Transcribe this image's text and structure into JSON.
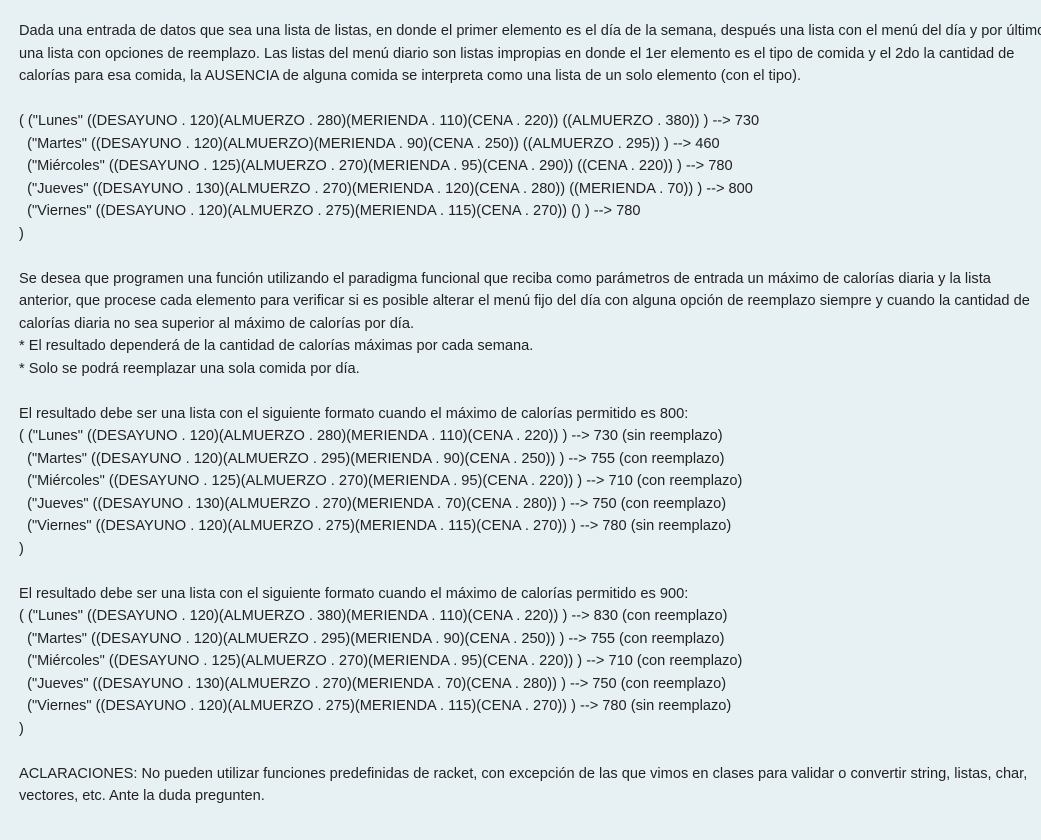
{
  "intro": [
    "Dada una entrada de datos que sea una lista de listas, en donde el primer elemento es el día de la semana, después una lista con el menú del día y por último",
    "una lista con opciones de reemplazo. Las listas del menú diario son listas impropias en donde el 1er elemento es el tipo de comida y el 2do la cantidad de",
    "calorías para esa comida, la AUSENCIA de alguna comida se interpreta como una lista de un solo elemento (con el tipo)."
  ],
  "input_example": [
    "( (\"Lunes\" ((DESAYUNO . 120)(ALMUERZO . 280)(MERIENDA . 110)(CENA . 220)) ((ALMUERZO . 380)) ) --> 730",
    "  (\"Martes\" ((DESAYUNO . 120)(ALMUERZO)(MERIENDA . 90)(CENA . 250)) ((ALMUERZO . 295)) ) --> 460",
    "  (\"Miércoles\" ((DESAYUNO . 125)(ALMUERZO . 270)(MERIENDA . 95)(CENA . 290)) ((CENA . 220)) ) --> 780",
    "  (\"Jueves\" ((DESAYUNO . 130)(ALMUERZO . 270)(MERIENDA . 120)(CENA . 280)) ((MERIENDA . 70)) ) --> 800",
    "  (\"Viernes\" ((DESAYUNO . 120)(ALMUERZO . 275)(MERIENDA . 115)(CENA . 270)) () ) --> 780",
    ")"
  ],
  "task": [
    "Se desea que programen una función utilizando el paradigma funcional que reciba como parámetros de entrada un máximo de calorías diaria y la lista",
    "anterior, que procese cada elemento para verificar si es posible alterar el menú fijo del día con alguna opción de reemplazo siempre y cuando la cantidad de",
    "calorías diaria no sea superior al máximo de calorías por día.",
    "* El resultado dependerá de la cantidad de calorías máximas por cada semana.",
    "* Solo se podrá reemplazar una sola comida por día."
  ],
  "result_800": [
    "El resultado debe ser una lista con el siguiente formato cuando el máximo de calorías permitido es 800:",
    "( (\"Lunes\" ((DESAYUNO . 120)(ALMUERZO . 280)(MERIENDA . 110)(CENA . 220)) ) --> 730 (sin reemplazo)",
    "  (\"Martes\" ((DESAYUNO . 120)(ALMUERZO . 295)(MERIENDA . 90)(CENA . 250)) ) --> 755 (con reemplazo)",
    "  (\"Miércoles\" ((DESAYUNO . 125)(ALMUERZO . 270)(MERIENDA . 95)(CENA . 220)) ) --> 710 (con reemplazo)",
    "  (\"Jueves\" ((DESAYUNO . 130)(ALMUERZO . 270)(MERIENDA . 70)(CENA . 280)) ) --> 750 (con reemplazo)",
    "  (\"Viernes\" ((DESAYUNO . 120)(ALMUERZO . 275)(MERIENDA . 115)(CENA . 270)) ) --> 780 (sin reemplazo)",
    ")"
  ],
  "result_900": [
    "El resultado debe ser una lista con el siguiente formato cuando el máximo de calorías permitido es 900:",
    "( (\"Lunes\" ((DESAYUNO . 120)(ALMUERZO . 380)(MERIENDA . 110)(CENA . 220)) ) --> 830 (con reemplazo)",
    "  (\"Martes\" ((DESAYUNO . 120)(ALMUERZO . 295)(MERIENDA . 90)(CENA . 250)) ) --> 755 (con reemplazo)",
    "  (\"Miércoles\" ((DESAYUNO . 125)(ALMUERZO . 270)(MERIENDA . 95)(CENA . 220)) ) --> 710 (con reemplazo)",
    "  (\"Jueves\" ((DESAYUNO . 130)(ALMUERZO . 270)(MERIENDA . 70)(CENA . 280)) ) --> 750 (con reemplazo)",
    "  (\"Viernes\" ((DESAYUNO . 120)(ALMUERZO . 275)(MERIENDA . 115)(CENA . 270)) ) --> 780 (sin reemplazo)",
    ")"
  ],
  "notes": [
    "ACLARACIONES: No pueden utilizar funciones predefinidas de racket, con excepción de las que vimos en clases para validar o convertir string, listas, char,",
    "vectores, etc. Ante la duda pregunten."
  ]
}
